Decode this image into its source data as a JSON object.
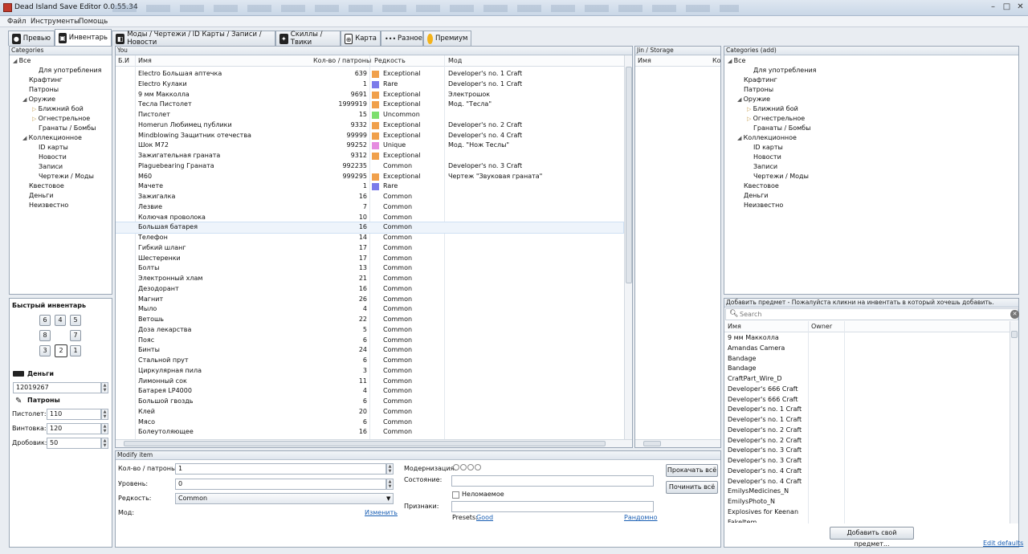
{
  "window": {
    "title": "Dead Island Save Editor 0.0.55.34"
  },
  "menu": [
    "Файл",
    "Инструменты",
    "Помощь"
  ],
  "tabs": [
    {
      "label": "Превью",
      "icon": "person-icon",
      "active": false
    },
    {
      "label": "Инвентарь",
      "icon": "backpack-icon",
      "active": true
    },
    {
      "label": "Моды / Чертежи / ID Карты / Записи / Новости",
      "icon": "blueprint-icon",
      "active": false
    },
    {
      "label": "Скиллы / Твики",
      "icon": "skills-icon",
      "active": false
    },
    {
      "label": "Карта",
      "icon": "crosshair-icon",
      "active": false
    },
    {
      "label": "Разное",
      "icon": "dots-icon",
      "active": false
    },
    {
      "label": "Премиум",
      "icon": "coin-icon",
      "active": false
    }
  ],
  "categories": {
    "title": "Categories",
    "items": [
      {
        "label": "Все",
        "level": 0,
        "toggle": "open"
      },
      {
        "label": "Для употребления",
        "level": 2,
        "toggle": ""
      },
      {
        "label": "Крафтинг",
        "level": 1,
        "toggle": ""
      },
      {
        "label": "Патроны",
        "level": 1,
        "toggle": ""
      },
      {
        "label": "Оружие",
        "level": 1,
        "toggle": "open"
      },
      {
        "label": "Ближний бой",
        "level": 2,
        "toggle": "closed"
      },
      {
        "label": "Огнестрельное",
        "level": 2,
        "toggle": "closed"
      },
      {
        "label": "Гранаты / Бомбы",
        "level": 2,
        "toggle": ""
      },
      {
        "label": "Коллекционное",
        "level": 1,
        "toggle": "open"
      },
      {
        "label": "ID карты",
        "level": 2,
        "toggle": ""
      },
      {
        "label": "Новости",
        "level": 2,
        "toggle": ""
      },
      {
        "label": "Записи",
        "level": 2,
        "toggle": ""
      },
      {
        "label": "Чертежи / Моды",
        "level": 2,
        "toggle": ""
      },
      {
        "label": "Квестовое",
        "level": 1,
        "toggle": ""
      },
      {
        "label": "Деньги",
        "level": 1,
        "toggle": ""
      },
      {
        "label": "Неизвестно",
        "level": 1,
        "toggle": ""
      }
    ]
  },
  "quick_inventory": {
    "title": "Быстрый инвентарь",
    "slots": [
      "6",
      "4",
      "5",
      "8",
      "7",
      "3",
      "2",
      "1"
    ],
    "selected": "2"
  },
  "money": {
    "label": "Деньги",
    "value": "12019267"
  },
  "ammo": {
    "label": "Патроны",
    "pistol_label": "Пистолет:",
    "pistol": "110",
    "rifle_label": "Винтовка:",
    "rifle": "120",
    "shotgun_label": "Дробовик:",
    "shotgun": "50"
  },
  "you": {
    "title": "You",
    "columns": {
      "bi": "Б.И",
      "name": "Имя",
      "qty": "Кол-во / патроны",
      "rarity": "Редкость",
      "mod": "Мод"
    },
    "rows": [
      {
        "name": "Electro Большая аптечка",
        "qty": "639",
        "color": "#f0a04b",
        "rarity": "Exceptional",
        "mod": "Developer's no. 1 Craft"
      },
      {
        "name": "Electro Кулаки",
        "qty": "1",
        "color": "#7b7bea",
        "rarity": "Rare",
        "mod": "Developer's no. 1 Craft"
      },
      {
        "name": "9 мм Макколла",
        "qty": "9691",
        "color": "#f0a04b",
        "rarity": "Exceptional",
        "mod": "Электрошок"
      },
      {
        "name": "Тесла Пистолет",
        "qty": "1999919",
        "color": "#f0a04b",
        "rarity": "Exceptional",
        "mod": "Мод. \"Тесла\""
      },
      {
        "name": "Пистолет",
        "qty": "15",
        "color": "#7ddf6e",
        "rarity": "Uncommon",
        "mod": ""
      },
      {
        "name": "Homerun Любимец публики",
        "qty": "9332",
        "color": "#f0a04b",
        "rarity": "Exceptional",
        "mod": "Developer's no. 2 Craft"
      },
      {
        "name": "Mindblowing Защитник отечества",
        "qty": "99999",
        "color": "#f0a04b",
        "rarity": "Exceptional",
        "mod": "Developer's no. 4 Craft"
      },
      {
        "name": "Шок M72",
        "qty": "99252",
        "color": "#e58be0",
        "rarity": "Unique",
        "mod": "Мод. \"Нож Теслы\""
      },
      {
        "name": "Зажигательная граната",
        "qty": "9312",
        "color": "#f0a04b",
        "rarity": "Exceptional",
        "mod": ""
      },
      {
        "name": "Plaguebearing Граната",
        "qty": "992235",
        "color": "",
        "rarity": "Common",
        "mod": "Developer's no. 3 Craft"
      },
      {
        "name": "M60",
        "qty": "999295",
        "color": "#f0a04b",
        "rarity": "Exceptional",
        "mod": "Чертеж \"Звуковая граната\""
      },
      {
        "name": "Мачете",
        "qty": "1",
        "color": "#7b7bea",
        "rarity": "Rare",
        "mod": ""
      },
      {
        "name": "Зажигалка",
        "qty": "16",
        "color": "",
        "rarity": "Common",
        "mod": ""
      },
      {
        "name": "Лезвие",
        "qty": "7",
        "color": "",
        "rarity": "Common",
        "mod": ""
      },
      {
        "name": "Колючая проволока",
        "qty": "10",
        "color": "",
        "rarity": "Common",
        "mod": ""
      },
      {
        "name": "Большая батарея",
        "qty": "16",
        "color": "",
        "rarity": "Common",
        "mod": "",
        "selected": true
      },
      {
        "name": "Телефон",
        "qty": "14",
        "color": "",
        "rarity": "Common",
        "mod": ""
      },
      {
        "name": "Гибкий шланг",
        "qty": "17",
        "color": "",
        "rarity": "Common",
        "mod": ""
      },
      {
        "name": "Шестеренки",
        "qty": "17",
        "color": "",
        "rarity": "Common",
        "mod": ""
      },
      {
        "name": "Болты",
        "qty": "13",
        "color": "",
        "rarity": "Common",
        "mod": ""
      },
      {
        "name": "Электронный хлам",
        "qty": "21",
        "color": "",
        "rarity": "Common",
        "mod": ""
      },
      {
        "name": "Дезодорант",
        "qty": "16",
        "color": "",
        "rarity": "Common",
        "mod": ""
      },
      {
        "name": "Магнит",
        "qty": "26",
        "color": "",
        "rarity": "Common",
        "mod": ""
      },
      {
        "name": "Мыло",
        "qty": "4",
        "color": "",
        "rarity": "Common",
        "mod": ""
      },
      {
        "name": "Ветошь",
        "qty": "22",
        "color": "",
        "rarity": "Common",
        "mod": ""
      },
      {
        "name": "Доза лекарства",
        "qty": "5",
        "color": "",
        "rarity": "Common",
        "mod": ""
      },
      {
        "name": "Пояс",
        "qty": "6",
        "color": "",
        "rarity": "Common",
        "mod": ""
      },
      {
        "name": "Бинты",
        "qty": "24",
        "color": "",
        "rarity": "Common",
        "mod": ""
      },
      {
        "name": "Стальной прут",
        "qty": "6",
        "color": "",
        "rarity": "Common",
        "mod": ""
      },
      {
        "name": "Циркулярная пила",
        "qty": "3",
        "color": "",
        "rarity": "Common",
        "mod": ""
      },
      {
        "name": "Лимонный сок",
        "qty": "11",
        "color": "",
        "rarity": "Common",
        "mod": ""
      },
      {
        "name": "Батарея LP4000",
        "qty": "4",
        "color": "",
        "rarity": "Common",
        "mod": ""
      },
      {
        "name": "Большой гвоздь",
        "qty": "6",
        "color": "",
        "rarity": "Common",
        "mod": ""
      },
      {
        "name": "Клей",
        "qty": "20",
        "color": "",
        "rarity": "Common",
        "mod": ""
      },
      {
        "name": "Мясо",
        "qty": "6",
        "color": "",
        "rarity": "Common",
        "mod": ""
      },
      {
        "name": "Болеутоляющее",
        "qty": "16",
        "color": "",
        "rarity": "Common",
        "mod": ""
      }
    ]
  },
  "storage": {
    "title": "Jin / Storage",
    "col_name": "Имя",
    "col_qty": "Ко"
  },
  "categories_add": {
    "title": "Categories (add)",
    "items": [
      {
        "label": "Все",
        "level": 0,
        "toggle": "open"
      },
      {
        "label": "Для употребления",
        "level": 2,
        "toggle": ""
      },
      {
        "label": "Крафтинг",
        "level": 1,
        "toggle": ""
      },
      {
        "label": "Патроны",
        "level": 1,
        "toggle": ""
      },
      {
        "label": "Оружие",
        "level": 1,
        "toggle": "open"
      },
      {
        "label": "Ближний бой",
        "level": 2,
        "toggle": "closed"
      },
      {
        "label": "Огнестрельное",
        "level": 2,
        "toggle": "closed"
      },
      {
        "label": "Гранаты / Бомбы",
        "level": 2,
        "toggle": ""
      },
      {
        "label": "Коллекционное",
        "level": 1,
        "toggle": "open"
      },
      {
        "label": "ID карты",
        "level": 2,
        "toggle": ""
      },
      {
        "label": "Новости",
        "level": 2,
        "toggle": ""
      },
      {
        "label": "Записи",
        "level": 2,
        "toggle": ""
      },
      {
        "label": "Чертежи / Моды",
        "level": 2,
        "toggle": ""
      },
      {
        "label": "Квестовое",
        "level": 1,
        "toggle": ""
      },
      {
        "label": "Деньги",
        "level": 1,
        "toggle": ""
      },
      {
        "label": "Неизвестно",
        "level": 1,
        "toggle": ""
      }
    ]
  },
  "add_item": {
    "title": "Добавить предмет - Пожалуйста кликни на инвентать в который хочешь добавить.",
    "search_placeholder": "Search",
    "col_name": "Имя",
    "col_owner": "Owner",
    "items": [
      "9 мм Макколла",
      "Amandas Camera",
      "Bandage",
      "Bandage",
      "CraftPart_Wire_D",
      "Developer's 666 Craft",
      "Developer's 666 Craft",
      "Developer's no. 1 Craft",
      "Developer's no. 1 Craft",
      "Developer's no. 2 Craft",
      "Developer's no. 2 Craft",
      "Developer's no. 3 Craft",
      "Developer's no. 3 Craft",
      "Developer's no. 4 Craft",
      "Developer's no. 4 Craft",
      "EmilysMedicines_N",
      "EmilysPhoto_N",
      "Explosives for Keenan",
      "FakeItem"
    ],
    "add_custom_button": "Добавить свой предмет...",
    "edit_defaults": "Edit defaults"
  },
  "modify": {
    "title": "Modify item",
    "qty_label": "Кол-во / патроны:",
    "qty": "1",
    "level_label": "Уровень:",
    "level": "0",
    "rarity_label": "Редкость:",
    "rarity": "Common",
    "mod_label": "Мод:",
    "mod_link": "Изменить",
    "modernization_label": "Модернизация:",
    "state_label": "Состояние:",
    "unbreakable_label": "Неломаемое",
    "traits_label": "Признаки:",
    "presets_label": "Presets:",
    "presets_good": "Good",
    "randomize": "Рандомно",
    "upgrade_all": "Прокачать всё",
    "repair_all": "Починить всё"
  }
}
